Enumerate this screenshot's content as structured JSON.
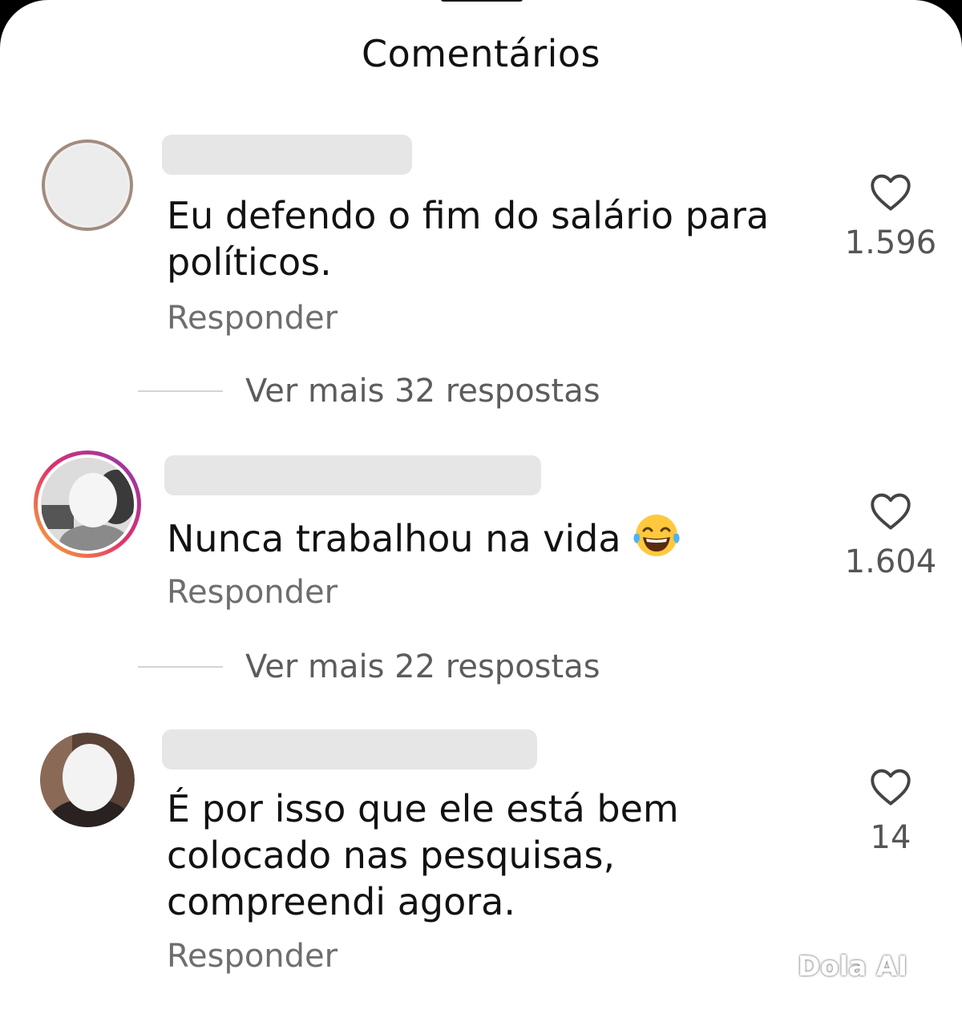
{
  "header": {
    "title": "Comentários"
  },
  "comments": [
    {
      "text": "Eu defendo o fim do salário para políticos.",
      "reply_label": "Responder",
      "likes": "1.596",
      "view_more": "Ver mais 32 respostas"
    },
    {
      "text": "Nunca trabalhou na vida",
      "reply_label": "Responder",
      "likes": "1.604",
      "view_more": "Ver mais 22 respostas"
    },
    {
      "text": "É por isso que ele está bem colocado nas pesquisas, compreendi agora.",
      "reply_label": "Responder",
      "likes": "14"
    }
  ],
  "icons": {
    "like": "heart-icon",
    "emoji": "face-with-tears-of-joy"
  },
  "watermark": "Dola AI",
  "colors": {
    "story_ring": [
      "#f9b234",
      "#e1306c",
      "#833ab4"
    ]
  }
}
